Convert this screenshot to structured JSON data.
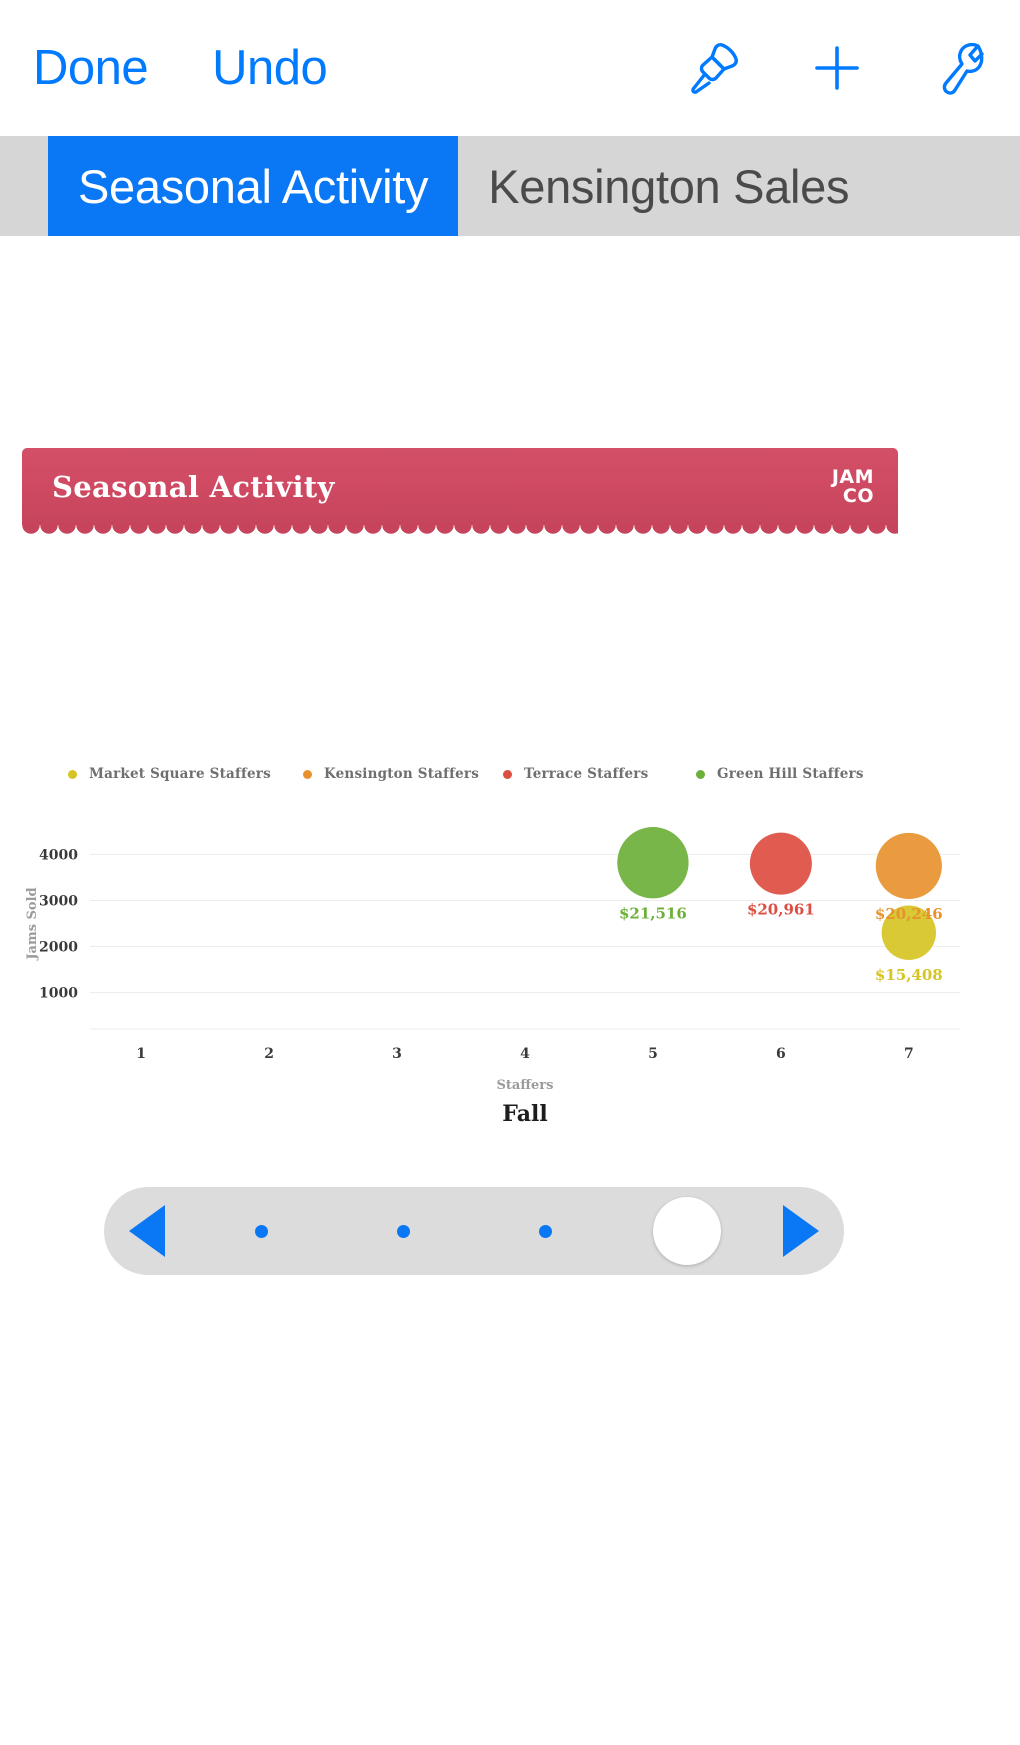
{
  "toolbar": {
    "done_label": "Done",
    "undo_label": "Undo",
    "icons": [
      {
        "name": "paint-brush-icon",
        "color": "#007aff"
      },
      {
        "name": "plus-icon",
        "color": "#007aff"
      },
      {
        "name": "wrench-icon",
        "color": "#007aff"
      }
    ]
  },
  "tabs": [
    {
      "label": "Seasonal Activity",
      "active": true
    },
    {
      "label": "Kensington Sales",
      "active": false
    }
  ],
  "report": {
    "banner_title": "Seasonal Activity",
    "logo_line1": "JAM",
    "logo_line2": "CO",
    "banner_color": "#cf4a62"
  },
  "slider": {
    "prev_label": "◀",
    "next_label": "▶",
    "stops": 4,
    "selected_index": 3
  },
  "chart_data": {
    "type": "scatter",
    "title": "Seasonal Activity",
    "frame_label": "Fall",
    "xlabel": "Staffers",
    "ylabel": "Jams Sold",
    "xticks": [
      "1",
      "2",
      "3",
      "4",
      "5",
      "6",
      "7"
    ],
    "yticks": [
      "1000",
      "2000",
      "3000",
      "4000"
    ],
    "xlim": [
      0.6,
      7.4
    ],
    "ylim": [
      600,
      4400
    ],
    "grid": true,
    "legend_position": "top",
    "series": [
      {
        "name": "Market Square Staffers",
        "color": "#d6c424",
        "x": 7,
        "y": 2300,
        "size": 1000,
        "label": "$15,408"
      },
      {
        "name": "Kensington Staffers",
        "color": "#e8922f",
        "x": 7,
        "y": 3750,
        "size": 1480,
        "label": "$20,246"
      },
      {
        "name": "Terrace Staffers",
        "color": "#dd4e42",
        "x": 6,
        "y": 3800,
        "size": 1300,
        "label": "$20,961"
      },
      {
        "name": "Green Hill Staffers",
        "color": "#6cb03a",
        "x": 5,
        "y": 3820,
        "size": 1720,
        "label": "$21,516"
      }
    ]
  }
}
